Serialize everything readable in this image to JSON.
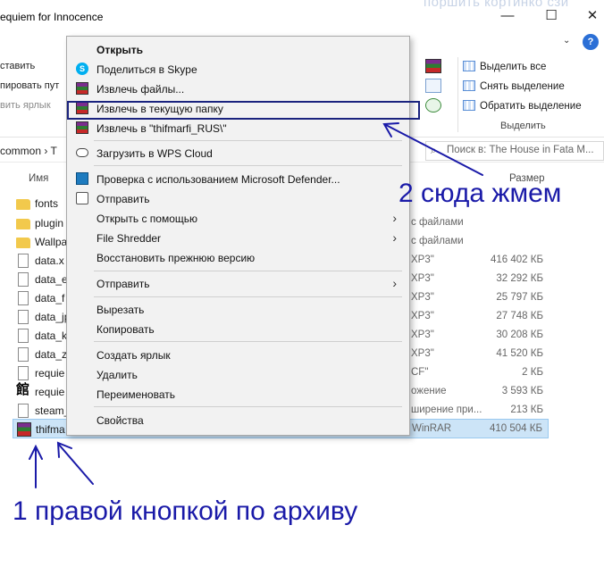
{
  "window": {
    "title": "equiem for Innocence",
    "title_ghost": "поршить кортинко сзи",
    "btn_minimize": "—",
    "btn_maximize": "☐",
    "btn_close": "✕",
    "help": "?"
  },
  "ribbon": {
    "left_items": [
      "ставить",
      "пировать пут",
      "вить ярлык"
    ],
    "select_all": "Выделить все",
    "select_none": "Снять выделение",
    "invert_selection": "Обратить выделение",
    "group_label": "Выделить"
  },
  "address": {
    "path": "common  ›  T",
    "search_placeholder": "Поиск в: The House in Fata M..."
  },
  "columns": {
    "name": "Имя",
    "size": "Размер"
  },
  "files": [
    {
      "name": "fonts",
      "type": "",
      "size": "",
      "icon": "folder-icon"
    },
    {
      "name": "plugin",
      "type": "с файлами",
      "size": "",
      "icon": "folder-icon"
    },
    {
      "name": "Wallpa",
      "type": "с файлами",
      "size": "",
      "icon": "folder-icon"
    },
    {
      "name": "data.x",
      "type": "XP3\"",
      "size": "416 402 КБ",
      "icon": "document-icon"
    },
    {
      "name": "data_e",
      "type": "XP3\"",
      "size": "32 292 КБ",
      "icon": "document-icon"
    },
    {
      "name": "data_f",
      "type": "XP3\"",
      "size": "25 797 КБ",
      "icon": "document-icon"
    },
    {
      "name": "data_jp",
      "type": "XP3\"",
      "size": "27 748 КБ",
      "icon": "document-icon"
    },
    {
      "name": "data_k",
      "type": "XP3\"",
      "size": "30 208 КБ",
      "icon": "document-icon"
    },
    {
      "name": "data_z",
      "type": "XP3\"",
      "size": "41 520 КБ",
      "icon": "document-icon"
    },
    {
      "name": "requie",
      "type": "CF\"",
      "size": "2 КБ",
      "icon": "document-icon"
    },
    {
      "name": "requie",
      "type": "ожение",
      "size": "3 593 КБ",
      "icon": "app-icon"
    },
    {
      "name": "steam_",
      "type": "ширение при...",
      "size": "213 КБ",
      "icon": "document-icon"
    },
    {
      "name": "thifma",
      "type": "WinRAR",
      "size": "410 504 КБ",
      "icon": "winrar-icon"
    }
  ],
  "context_menu": {
    "open": "Открыть",
    "skype": "Поделиться в Skype",
    "extract_files": "Извлечь файлы...",
    "extract_here": "Извлечь в текущую папку",
    "extract_to": "Извлечь в \"thifmarfi_RUS\\\"",
    "wps_cloud": "Загрузить в WPS Cloud",
    "defender": "Проверка с использованием Microsoft Defender...",
    "send_share": "Отправить",
    "open_with": "Открыть с помощью",
    "shredder": "File Shredder",
    "restore": "Восстановить прежнюю версию",
    "send_to": "Отправить",
    "cut": "Вырезать",
    "copy": "Копировать",
    "create_shortcut": "Создать ярлык",
    "delete": "Удалить",
    "rename": "Переименовать",
    "properties": "Свойства"
  },
  "annotations": {
    "step2": "2 сюда жмем",
    "step1": "1 правой кнопкой по архиву"
  },
  "colors": {
    "annotation": "#1a1aa8",
    "selection": "#cce4f7",
    "menu_bg": "#f2f2f2"
  }
}
